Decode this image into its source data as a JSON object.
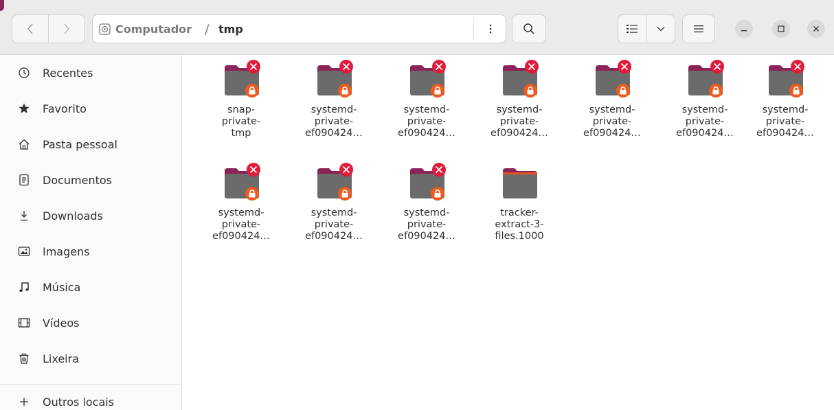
{
  "window": {
    "path": {
      "root": "Computador",
      "separator": "/",
      "current": "tmp"
    },
    "icons": {
      "back": "chevron-left-icon",
      "forward": "chevron-right-icon",
      "location": "drive-icon",
      "path_menu": "vertical-dots-icon",
      "search": "search-icon",
      "view": "list-view-icon",
      "view_options": "chevron-down-icon",
      "main_menu": "hamburger-menu-icon",
      "minimize": "minimize-icon",
      "maximize": "maximize-icon",
      "close": "close-icon"
    }
  },
  "sidebar": {
    "items": [
      {
        "label": "Recentes",
        "icon": "clock-icon"
      },
      {
        "label": "Favorito",
        "icon": "star-icon"
      },
      {
        "label": "Pasta pessoal",
        "icon": "home-icon"
      },
      {
        "label": "Documentos",
        "icon": "document-icon"
      },
      {
        "label": "Downloads",
        "icon": "download-icon"
      },
      {
        "label": "Imagens",
        "icon": "image-icon"
      },
      {
        "label": "Música",
        "icon": "music-icon"
      },
      {
        "label": "Vídeos",
        "icon": "video-icon"
      },
      {
        "label": "Lixeira",
        "icon": "trash-icon"
      },
      {
        "label": "Outros locais",
        "icon": "plus-icon"
      }
    ]
  },
  "files": [
    {
      "name": "snap-\nprivate-\ntmp",
      "locked": true
    },
    {
      "name": "systemd-\nprivate-\nef090424…",
      "locked": true
    },
    {
      "name": "systemd-\nprivate-\nef090424…",
      "locked": true
    },
    {
      "name": "systemd-\nprivate-\nef090424…",
      "locked": true
    },
    {
      "name": "systemd-\nprivate-\nef090424…",
      "locked": true
    },
    {
      "name": "systemd-\nprivate-\nef090424…",
      "locked": true
    },
    {
      "name": "systemd-\nprivate-\nef090424…",
      "locked": true
    },
    {
      "name": "systemd-\nprivate-\nef090424…",
      "locked": true
    },
    {
      "name": "systemd-\nprivate-\nef090424…",
      "locked": true
    },
    {
      "name": "systemd-\nprivate-\nef090424…",
      "locked": true
    },
    {
      "name": "tracker-\nextract-3-\nfiles.1000",
      "locked": false
    }
  ],
  "colors": {
    "folder_tab": "#8a2458",
    "folder_body": "#6b6b6b",
    "no_access_badge": "#e01b3c",
    "lock_badge": "#ed5b1f",
    "accent": "#e95420"
  }
}
